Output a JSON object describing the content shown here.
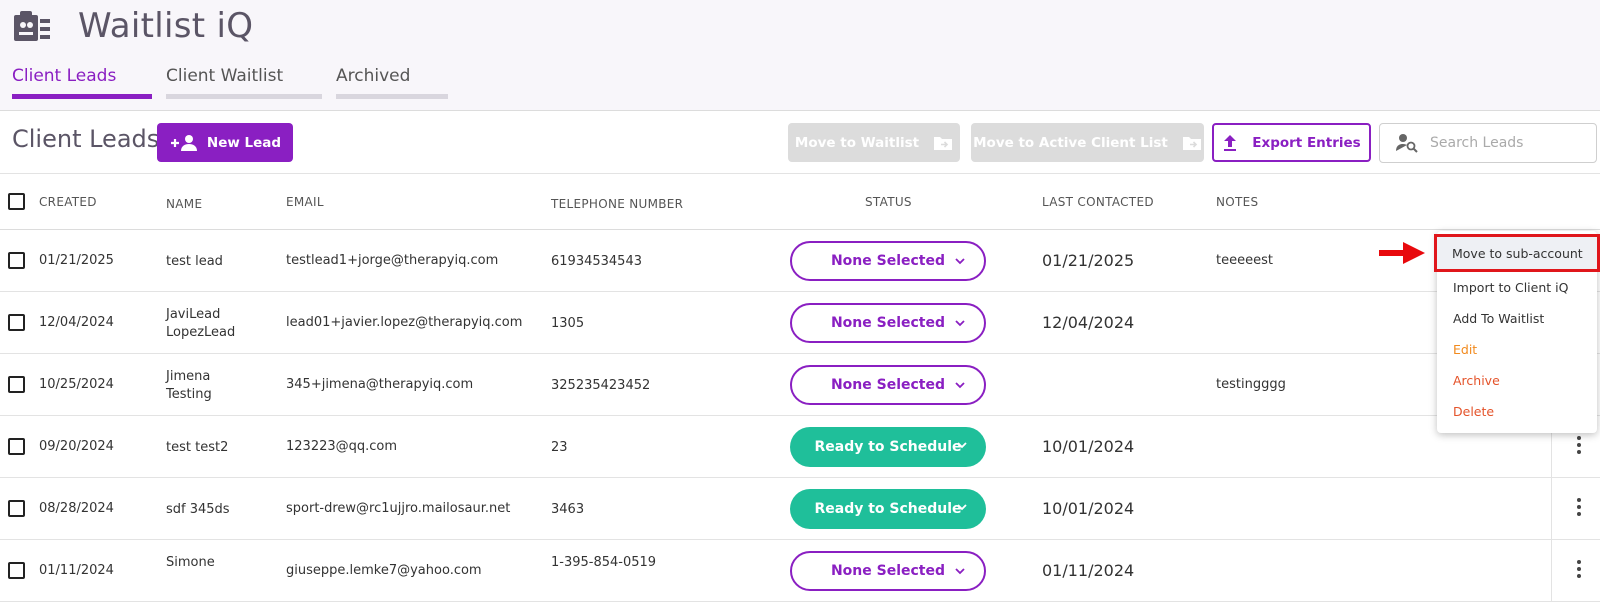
{
  "app": {
    "title": "Waitlist iQ",
    "logo_icon": "clipboard-list-icon"
  },
  "tabs": [
    {
      "label": "Client Leads",
      "active": true
    },
    {
      "label": "Client Waitlist",
      "active": false
    },
    {
      "label": "Archived",
      "active": false
    }
  ],
  "toolbar": {
    "page_title": "Client Leads",
    "new_lead": "New Lead",
    "move_waitlist": "Move to Waitlist",
    "move_active": "Move to Active Client List",
    "export": "Export Entries",
    "search_placeholder": "Search Leads"
  },
  "columns": {
    "created": "CREATED",
    "name": "NAME",
    "email": "EMAIL",
    "tel": "TELEPHONE NUMBER",
    "status": "STATUS",
    "last": "LAST CONTACTED",
    "notes": "NOTES"
  },
  "rows": [
    {
      "created": "01/21/2025",
      "name1": "test lead",
      "name2": "",
      "email": "testlead1+jorge@therapyiq.com",
      "tel1": "61934534543",
      "tel2": "",
      "status": "None Selected",
      "status_type": "none",
      "last": "01/21/2025",
      "notes": "teeeeest"
    },
    {
      "created": "12/04/2024",
      "name1": "JaviLead",
      "name2": "LopezLead",
      "email": "lead01+javier.lopez@therapyiq.com",
      "tel1": "1305",
      "tel2": "",
      "status": "None Selected",
      "status_type": "none",
      "last": "12/04/2024",
      "notes": ""
    },
    {
      "created": "10/25/2024",
      "name1": "Jimena",
      "name2": "Testing",
      "email": "345+jimena@therapyiq.com",
      "tel1": "325235423452",
      "tel2": "",
      "status": "None Selected",
      "status_type": "none",
      "last": "",
      "notes": "testingggg"
    },
    {
      "created": "09/20/2024",
      "name1": "test test2",
      "name2": "",
      "email": "123223@qq.com",
      "tel1": "23",
      "tel2": "",
      "status": "Ready to Schedule",
      "status_type": "ready",
      "last": "10/01/2024",
      "notes": ""
    },
    {
      "created": "08/28/2024",
      "name1": "sdf 345ds",
      "name2": "",
      "email": "sport-drew@rc1ujjro.mailosaur.net",
      "tel1": "3463",
      "tel2": "",
      "status": "Ready to Schedule",
      "status_type": "ready",
      "last": "10/01/2024",
      "notes": ""
    },
    {
      "created": "01/11/2024",
      "name1": "Simone",
      "name2": "",
      "email": "giuseppe.lemke7@yahoo.com",
      "tel1": "1-395-854-0519",
      "tel2": "",
      "status": "None Selected",
      "status_type": "none",
      "last": "01/11/2024",
      "notes": ""
    }
  ],
  "menu": [
    {
      "label": "Move to sub-account",
      "style": "highlight"
    },
    {
      "label": "Import to Client iQ",
      "style": ""
    },
    {
      "label": "Add To Waitlist",
      "style": ""
    },
    {
      "label": "Edit",
      "style": "orange"
    },
    {
      "label": "Archive",
      "style": "red"
    },
    {
      "label": "Delete",
      "style": "red"
    }
  ],
  "colors": {
    "brand": "#8a1fc2",
    "ready": "#1fbf9a",
    "highlight": "#e0161b"
  }
}
